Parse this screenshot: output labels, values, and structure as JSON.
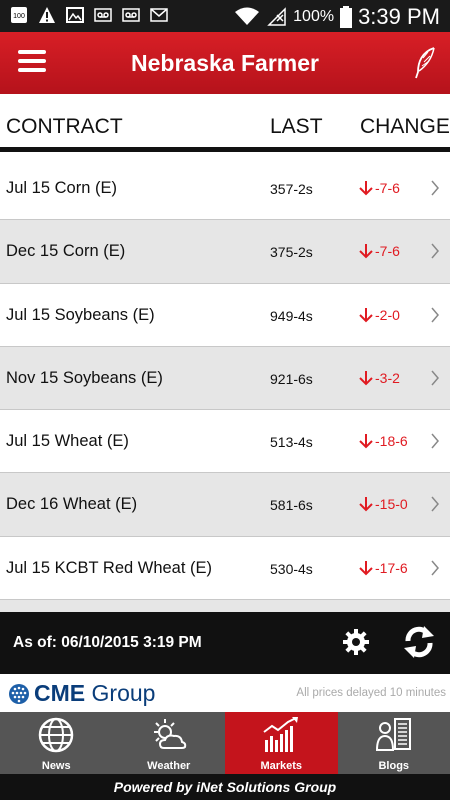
{
  "status_bar": {
    "notification_badge": "100",
    "battery_pct": "100%",
    "time": "3:39 PM",
    "icons": [
      "badge-icon",
      "warning-icon",
      "image-icon",
      "voicemail-icon",
      "voicemail-icon",
      "mail-icon",
      "wifi-icon",
      "no-signal-icon",
      "battery-icon"
    ]
  },
  "header": {
    "title": "Nebraska Farmer",
    "menu_icon": "hamburger-icon",
    "logo_icon": "feather-icon"
  },
  "table": {
    "columns": [
      "CONTRACT",
      "LAST",
      "CHANGE"
    ],
    "rows": [
      {
        "contract": "Jul 15 Corn (E)",
        "last": "357-2s",
        "change": "-7-6",
        "direction": "down"
      },
      {
        "contract": "Dec 15 Corn (E)",
        "last": "375-2s",
        "change": "-7-6",
        "direction": "down"
      },
      {
        "contract": "Jul 15 Soybeans (E)",
        "last": "949-4s",
        "change": "-2-0",
        "direction": "down"
      },
      {
        "contract": "Nov 15 Soybeans (E)",
        "last": "921-6s",
        "change": "-3-2",
        "direction": "down"
      },
      {
        "contract": "Jul 15 Wheat (E)",
        "last": "513-4s",
        "change": "-18-6",
        "direction": "down"
      },
      {
        "contract": "Dec 16 Wheat (E)",
        "last": "581-6s",
        "change": "-15-0",
        "direction": "down"
      },
      {
        "contract": "Jul 15 KCBT Red Wheat (E)",
        "last": "530-4s",
        "change": "-17-6",
        "direction": "down"
      }
    ]
  },
  "asof": {
    "text": "As of: 06/10/2015 3:19 PM",
    "settings_icon": "gear-icon",
    "refresh_icon": "refresh-icon"
  },
  "cme": {
    "logo_text_bold": "CME",
    "logo_text": "Group",
    "delay_note": "All prices delayed 10 minutes"
  },
  "tabs": [
    {
      "label": "News",
      "icon": "globe-icon",
      "active": false
    },
    {
      "label": "Weather",
      "icon": "weather-icon",
      "active": false
    },
    {
      "label": "Markets",
      "icon": "chart-icon",
      "active": true
    },
    {
      "label": "Blogs",
      "icon": "blog-icon",
      "active": false
    }
  ],
  "footer": {
    "powered_by": "Powered by iNet Solutions Group"
  },
  "colors": {
    "brand_red": "#c4141c",
    "change_red": "#e01b22",
    "row_alt": "#e6e6e6",
    "tab_bg": "#555555"
  }
}
